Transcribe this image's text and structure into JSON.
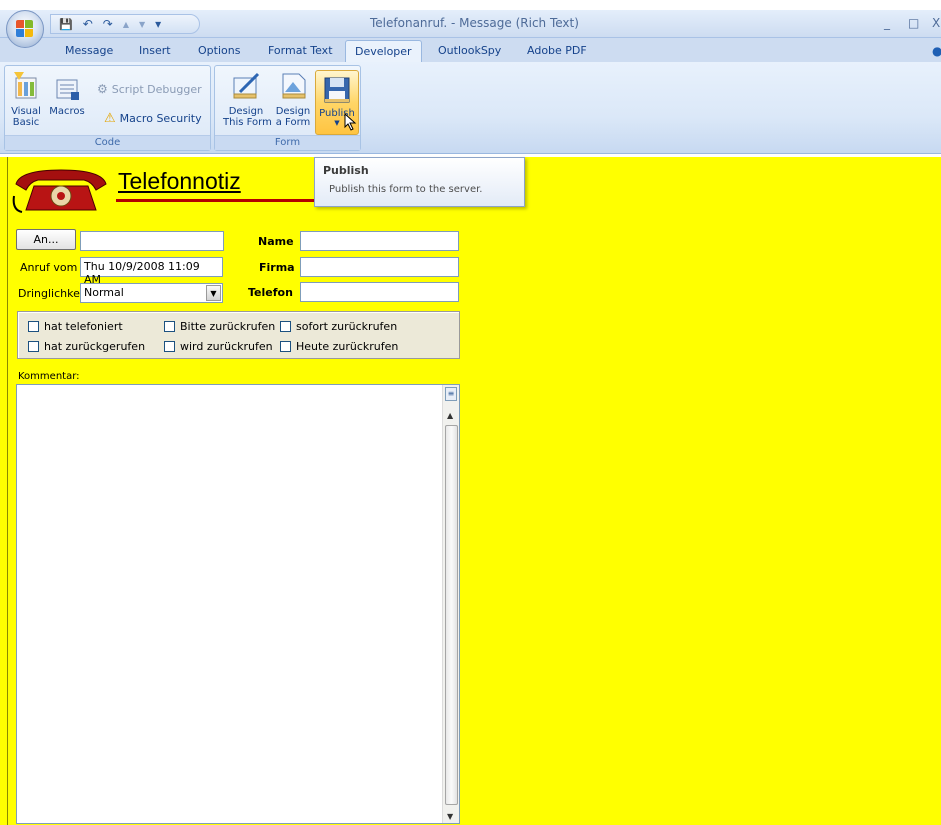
{
  "window": {
    "title": "Telefonanruf. - Message (Rich Text)",
    "minimize": "_",
    "maximize": "□",
    "close": "X"
  },
  "qat": {
    "save": "💾",
    "undo": "↶",
    "redo": "↷",
    "up": "▲",
    "down": "▼",
    "customize": "▾"
  },
  "tabs": [
    "Message",
    "Insert",
    "Options",
    "Format Text",
    "Developer",
    "OutlookSpy",
    "Adobe PDF"
  ],
  "active_tab": "Developer",
  "ribbon": {
    "code_group": {
      "label": "Code",
      "visual_basic": "Visual\nBasic",
      "macros": "Macros",
      "script_debugger": "Script Debugger",
      "macro_security": "Macro Security"
    },
    "form_group": {
      "label": "Form",
      "design_this_form": "Design\nThis Form",
      "design_a_form": "Design\na Form",
      "publish": "Publish"
    }
  },
  "tooltip": {
    "title": "Publish",
    "description": "Publish this form to the server."
  },
  "form": {
    "heading": "Telefonnotiz",
    "an_button": "An...",
    "an_value": "",
    "anruf_vom_label": "Anruf vom",
    "anruf_vom_value": "Thu 10/9/2008 11:09 AM",
    "dringlichkeit_label": "Dringlichkeit",
    "dringlichkeit_value": "Normal",
    "name_label": "Name",
    "name_value": "",
    "firma_label": "Firma",
    "firma_value": "",
    "telefon_label": "Telefon",
    "telefon_value": "",
    "checkboxes": [
      "hat telefoniert",
      "Bitte zurückrufen",
      "sofort zurückrufen",
      "hat zurückgerufen",
      "wird zurückrufen",
      "Heute zurückrufen"
    ],
    "kommentar_label": "Kommentar:",
    "kommentar_value": ""
  },
  "colors": {
    "form_bg": "#ffff00",
    "accent": "#15428b",
    "heading_rule": "#b30000"
  }
}
